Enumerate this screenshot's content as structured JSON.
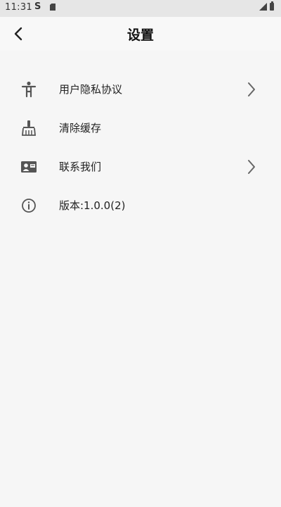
{
  "status_bar": {
    "time": "11:31",
    "s_icon": "S"
  },
  "header": {
    "title": "设置",
    "back_icon": "chevron-left-icon"
  },
  "menu": [
    {
      "label": "用户隐私协议",
      "icon": "person-icon",
      "has_chevron": true
    },
    {
      "label": "清除缓存",
      "icon": "broom-icon",
      "has_chevron": false
    },
    {
      "label": "联系我们",
      "icon": "contact-card-icon",
      "has_chevron": true
    },
    {
      "label": "版本:1.0.0(2)",
      "icon": "info-icon",
      "has_chevron": false
    }
  ],
  "colors": {
    "background": "#f6f6f6",
    "status_bar": "#e6e6e6",
    "icon": "#555555",
    "chevron": "#666666"
  }
}
